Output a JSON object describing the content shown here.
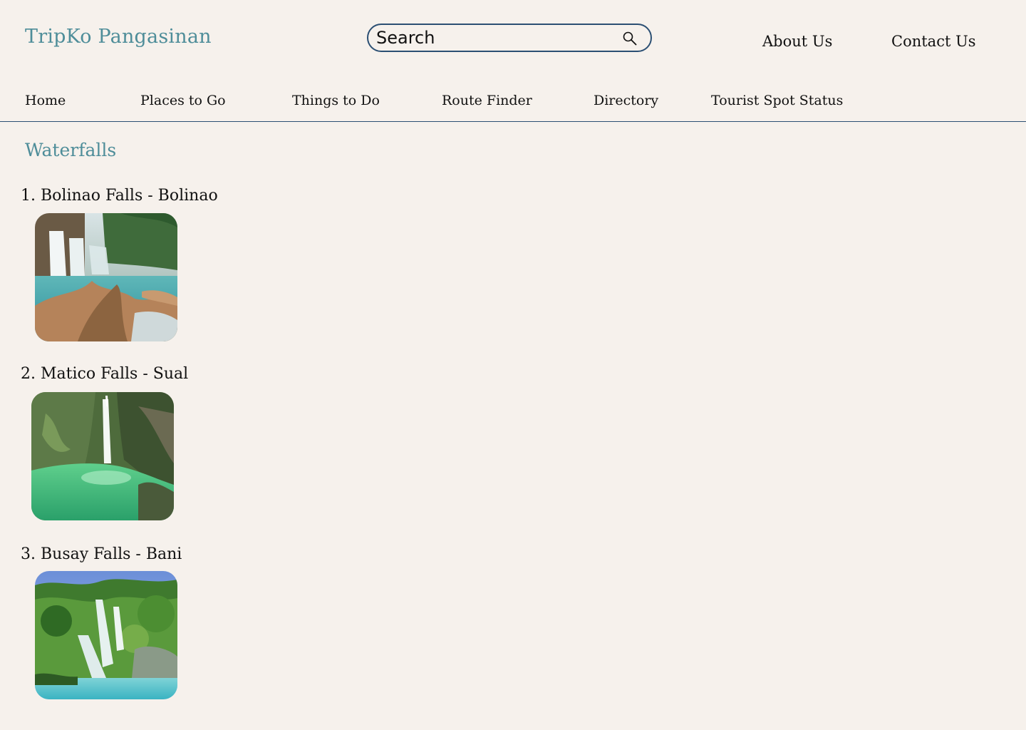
{
  "header": {
    "brand": "TripKo Pangasinan",
    "search_placeholder": "Search",
    "about": "About Us",
    "contact": "Contact Us"
  },
  "nav": {
    "home": "Home",
    "places": "Places to Go",
    "things": "Things to Do",
    "route": "Route Finder",
    "directory": "Directory",
    "status": "Tourist Spot Status"
  },
  "main": {
    "section_title": "Waterfalls",
    "items": [
      {
        "number": "1.",
        "label": "Bolinao Falls - Bolinao"
      },
      {
        "number": "2.",
        "label": "Matico Falls - Sual"
      },
      {
        "number": "3.",
        "label": "Busay Falls - Bani"
      }
    ]
  },
  "icons": {
    "search": "search-icon"
  },
  "colors": {
    "accent": "#4e8d99",
    "border": "#2b4f73",
    "background": "#f6f1ec"
  }
}
